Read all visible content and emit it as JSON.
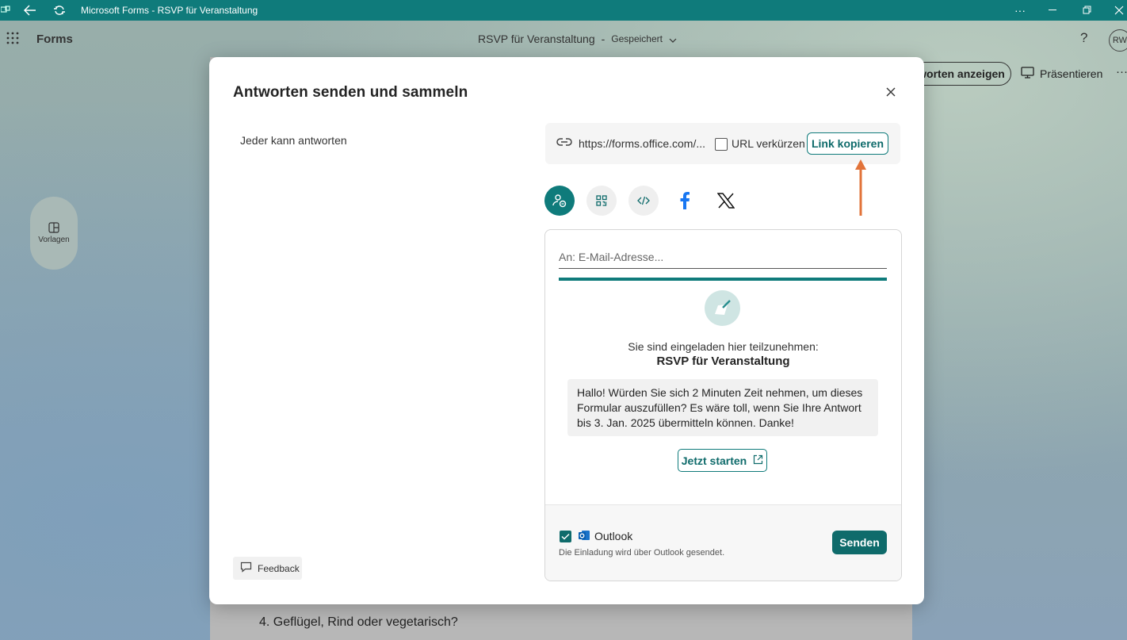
{
  "titlebar": {
    "title": "Microsoft Forms - RSVP für Veranstaltung",
    "more": "···"
  },
  "appbar": {
    "app_name": "Forms",
    "form_title": "RSVP für Veranstaltung",
    "separator": "-",
    "save_status": "Gespeichert",
    "help": "?",
    "avatar": "RW",
    "view_responses_label": "worten anzeigen",
    "present_label": "Präsentieren",
    "more": "···"
  },
  "sidebar": {
    "templates_label": "Vorlagen"
  },
  "background": {
    "question4": "4. Geflügel, Rind oder vegetarisch?"
  },
  "dialog": {
    "title": "Antworten senden und sammeln",
    "audience": "Jeder kann antworten",
    "link": {
      "url": "https://forms.office.com/...",
      "shorten_label": "URL verkürzen",
      "copy_label": "Link kopieren"
    },
    "share_icons": [
      "invite-icon",
      "qr-code-icon",
      "embed-code-icon",
      "facebook-icon",
      "x-icon"
    ],
    "email": {
      "to_placeholder": "An: E-Mail-Adresse...",
      "invite_line": "Sie sind eingeladen hier teilzunehmen:",
      "form_title": "RSVP für Veranstaltung",
      "message": "Hallo! Würden Sie sich 2 Minuten Zeit nehmen, um dieses Formular auszufüllen? Es wäre toll, wenn Sie Ihre Antwort bis 3. Jan. 2025 übermitteln können. Danke!",
      "start_label": "Jetzt starten",
      "outlook_label": "Outlook",
      "outlook_note": "Die Einladung wird über Outlook gesendet.",
      "send_label": "Senden"
    },
    "feedback_label": "Feedback"
  },
  "colors": {
    "accent": "#0f7b7b",
    "annotation_arrow": "#e2733a"
  }
}
